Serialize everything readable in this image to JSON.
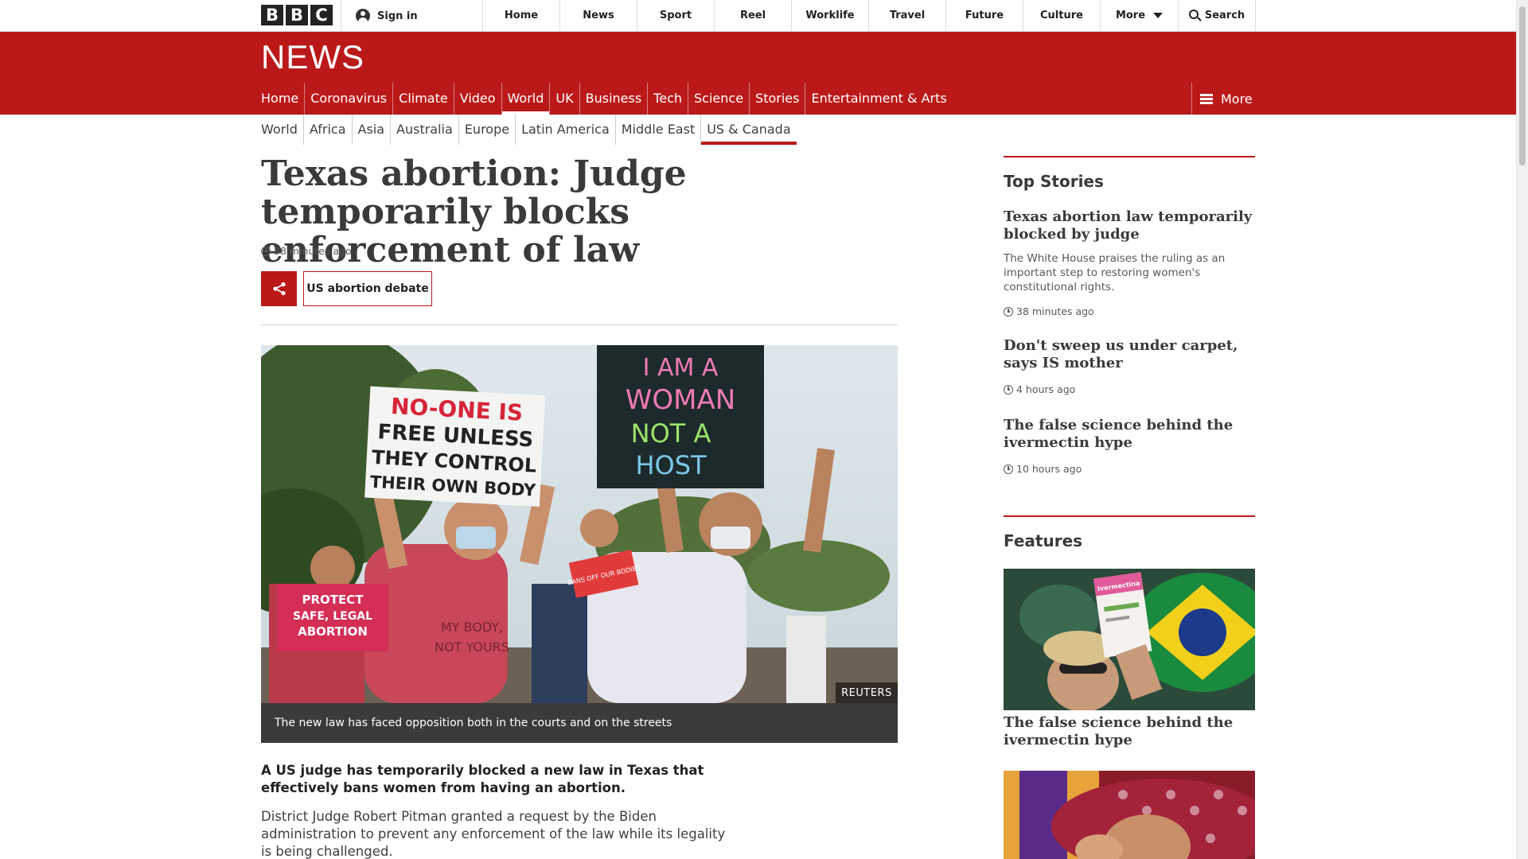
{
  "top_nav": {
    "logo_letters": [
      "B",
      "B",
      "C"
    ],
    "sign_in": "Sign in",
    "links": [
      "Home",
      "News",
      "Sport",
      "Reel",
      "Worklife",
      "Travel",
      "Future",
      "Culture"
    ],
    "more": "More",
    "search": "Search"
  },
  "news_logo": "NEWS",
  "main_nav": {
    "items": [
      "Home",
      "Coronavirus",
      "Climate",
      "Video",
      "World",
      "UK",
      "Business",
      "Tech",
      "Science",
      "Stories",
      "Entertainment & Arts"
    ],
    "active": "World",
    "more": "More"
  },
  "sub_nav": {
    "items": [
      "World",
      "Africa",
      "Asia",
      "Australia",
      "Europe",
      "Latin America",
      "Middle East",
      "US & Canada"
    ],
    "active": "US & Canada"
  },
  "article": {
    "headline": "Texas abortion: Judge temporarily blocks enforcement of law",
    "timestamp": "38 minutes ago",
    "tag": "US abortion debate",
    "image_credit": "REUTERS",
    "image_caption": "The new law has faced opposition both in the courts and on the streets",
    "image_signs": {
      "sign1": [
        "NO-ONE IS",
        "FREE UNLESS",
        "THEY CONTROL",
        "THEIR OWN BODY"
      ],
      "sign2": [
        "I AM A",
        "WOMAN",
        "NOT A",
        "HOST"
      ],
      "sign3": [
        "PROTECT",
        "SAFE, LEGAL",
        "ABORTION"
      ],
      "shirt": [
        "MY BODY,",
        "NOT YOURS"
      ],
      "small_sign": "BANS OFF OUR BODIES"
    },
    "intro": "A US judge has temporarily blocked a new law in Texas that effectively bans women from having an abortion.",
    "paragraph": "District Judge Robert Pitman granted a request by the Biden administration to prevent any enforcement of the law while its legality is being challenged."
  },
  "sidebar": {
    "top_stories_title": "Top Stories",
    "top_stories": [
      {
        "title": "Texas abortion law temporarily blocked by judge",
        "summary": "The White House praises the ruling as an important step to restoring women's constitutional rights.",
        "time": "38 minutes ago"
      },
      {
        "title": "Don't sweep us under carpet, says IS mother",
        "time": "4 hours ago"
      },
      {
        "title": "The false science behind the ivermectin hype",
        "time": "10 hours ago"
      }
    ],
    "features_title": "Features",
    "features": [
      {
        "title": "The false science behind the ivermectin hype",
        "image_text": "Ivermectina"
      }
    ]
  },
  "colors": {
    "bbc_red": "#bb1919",
    "text_dark": "#3a3a3a",
    "caption_bg": "#3a3a3a"
  }
}
